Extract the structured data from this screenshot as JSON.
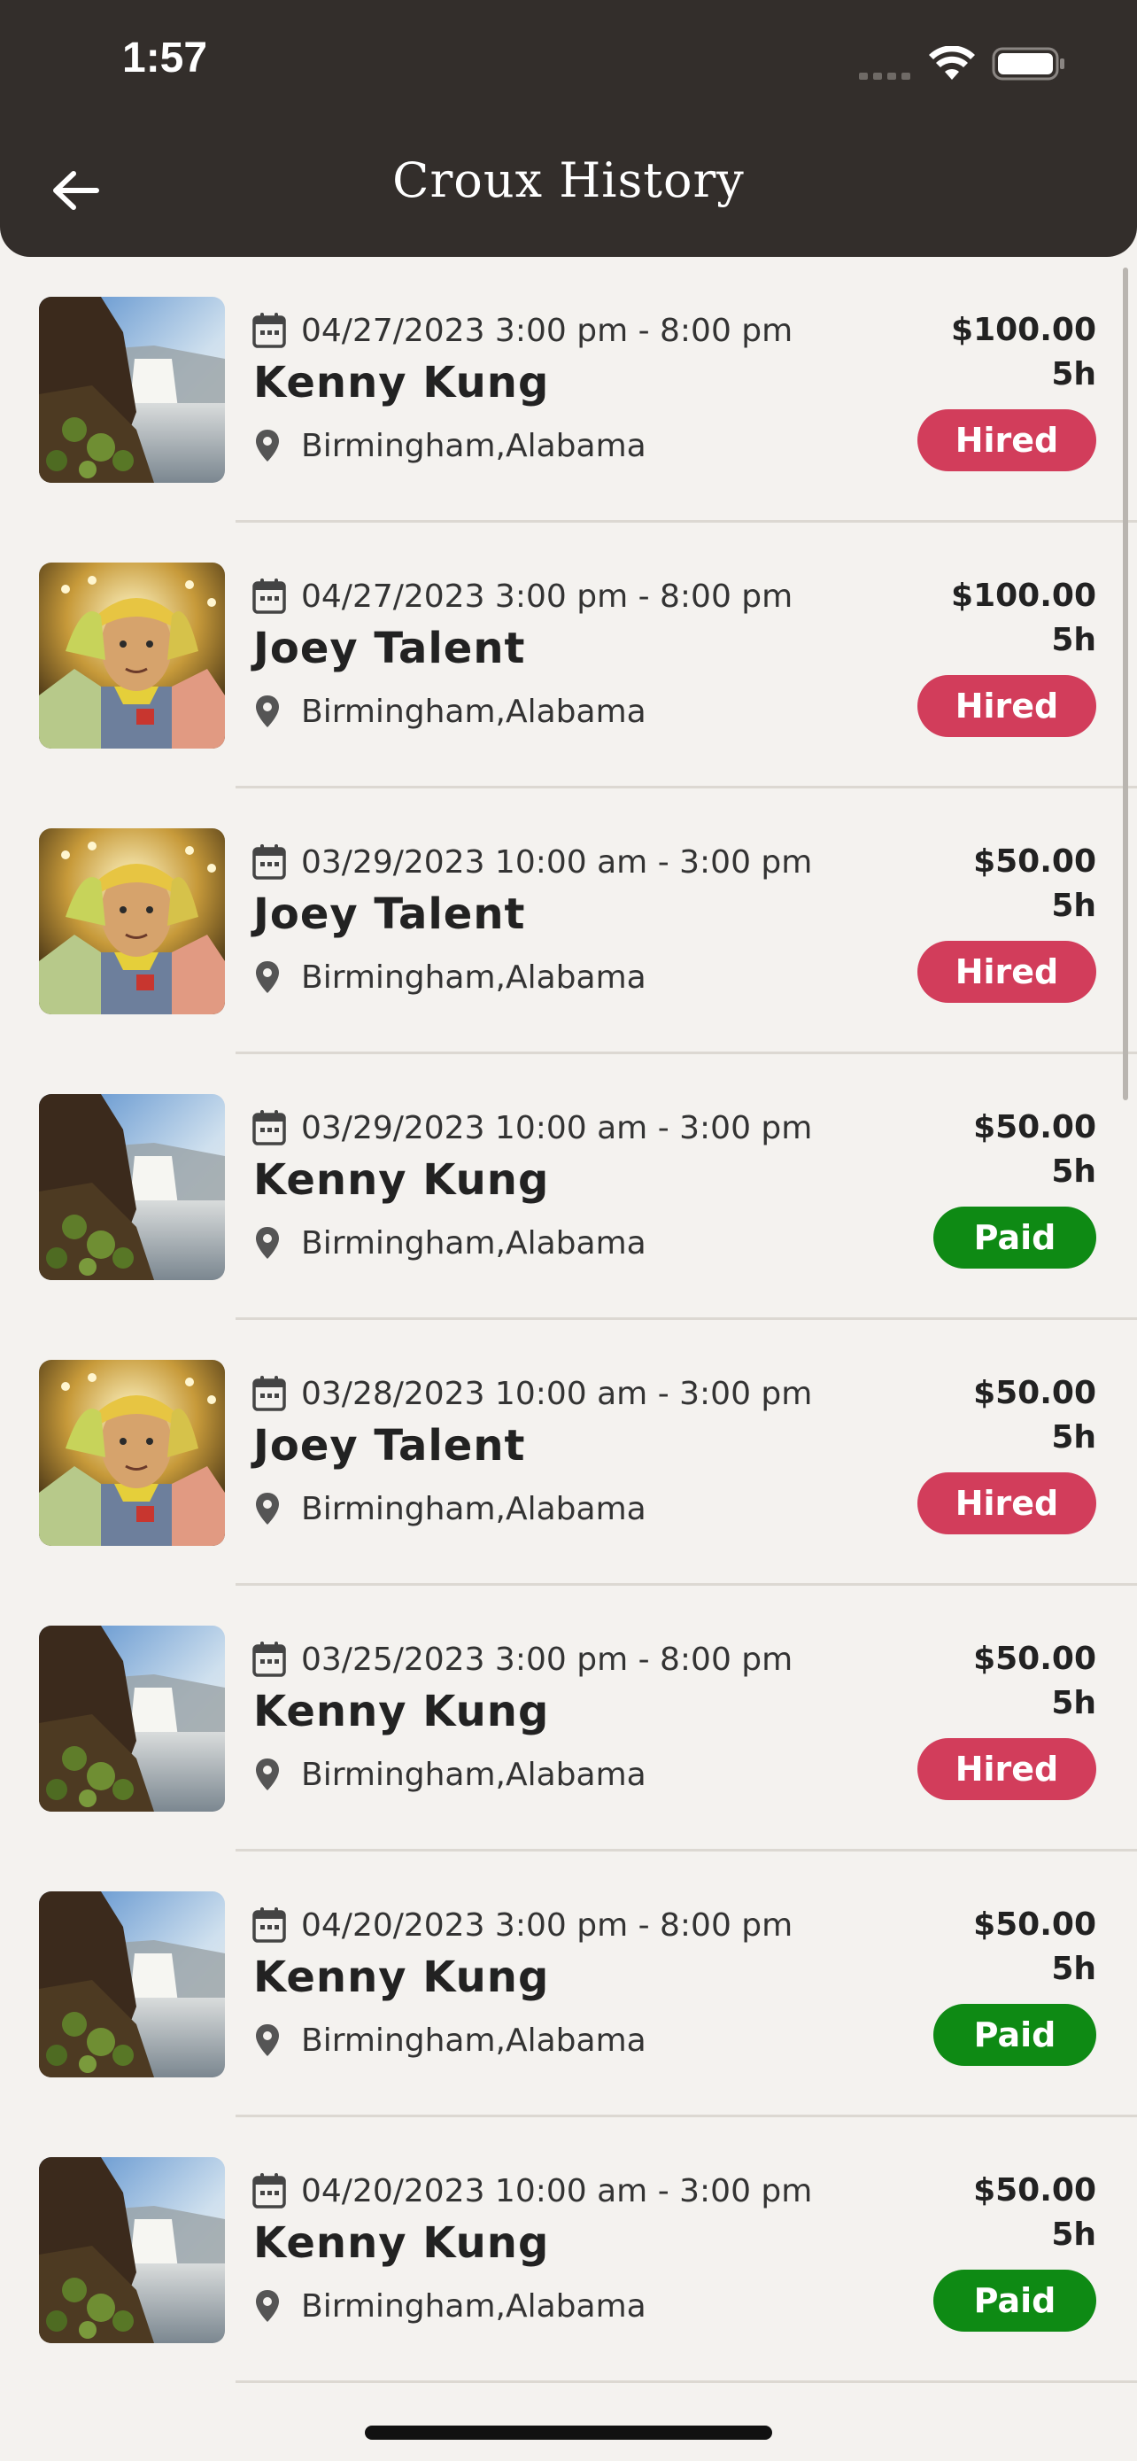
{
  "status_bar": {
    "time": "1:57"
  },
  "header": {
    "title": "Croux History"
  },
  "colors": {
    "header_bg": "#332e2b",
    "hired": "#d23d5b",
    "paid": "#0e8a14",
    "background": "#f4f2ef"
  },
  "items": [
    {
      "date": "04/27/2023 3:00 pm - 8:00 pm",
      "name": "Kenny Kung",
      "location": "Birmingham,Alabama",
      "price": "$100.00",
      "hours": "5h",
      "status": "Hired",
      "photo": "waterfall"
    },
    {
      "date": "04/27/2023 3:00 pm - 8:00 pm",
      "name": "Joey Talent",
      "location": "Birmingham,Alabama",
      "price": "$100.00",
      "hours": "5h",
      "status": "Hired",
      "photo": "person"
    },
    {
      "date": "03/29/2023 10:00 am - 3:00 pm",
      "name": "Joey Talent",
      "location": "Birmingham,Alabama",
      "price": "$50.00",
      "hours": "5h",
      "status": "Hired",
      "photo": "person"
    },
    {
      "date": "03/29/2023 10:00 am - 3:00 pm",
      "name": "Kenny Kung",
      "location": "Birmingham,Alabama",
      "price": "$50.00",
      "hours": "5h",
      "status": "Paid",
      "photo": "waterfall"
    },
    {
      "date": "03/28/2023 10:00 am - 3:00 pm",
      "name": "Joey Talent",
      "location": "Birmingham,Alabama",
      "price": "$50.00",
      "hours": "5h",
      "status": "Hired",
      "photo": "person"
    },
    {
      "date": "03/25/2023 3:00 pm - 8:00 pm",
      "name": "Kenny Kung",
      "location": "Birmingham,Alabama",
      "price": "$50.00",
      "hours": "5h",
      "status": "Hired",
      "photo": "waterfall"
    },
    {
      "date": "04/20/2023 3:00 pm - 8:00 pm",
      "name": "Kenny Kung",
      "location": "Birmingham,Alabama",
      "price": "$50.00",
      "hours": "5h",
      "status": "Paid",
      "photo": "waterfall"
    },
    {
      "date": "04/20/2023 10:00 am - 3:00 pm",
      "name": "Kenny Kung",
      "location": "Birmingham,Alabama",
      "price": "$50.00",
      "hours": "5h",
      "status": "Paid",
      "photo": "waterfall"
    }
  ]
}
